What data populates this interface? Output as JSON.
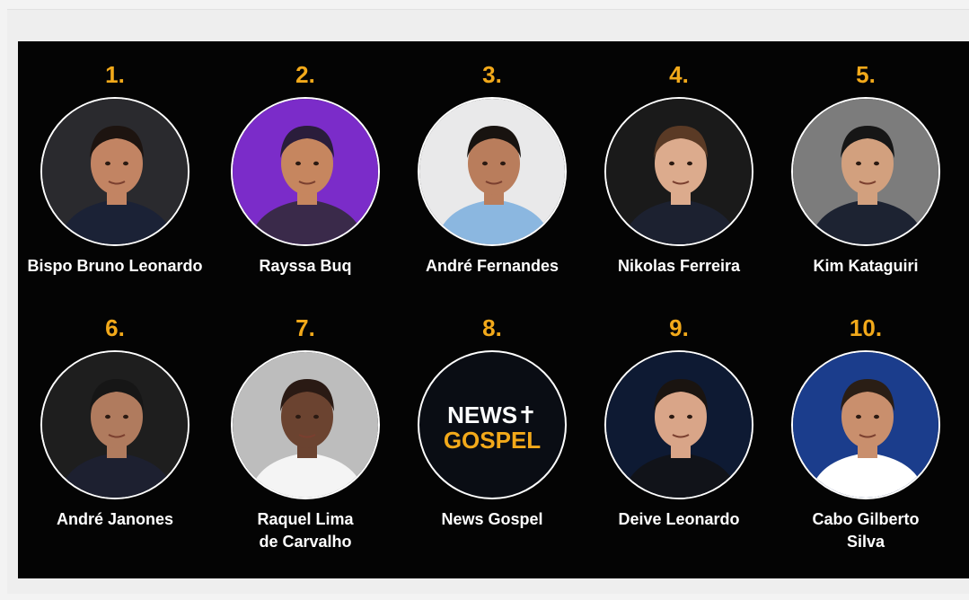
{
  "ranking": [
    {
      "rank": "1.",
      "name": "Bispo Bruno Leonardo",
      "bg": "#2a2a2e",
      "skin": "#c28463",
      "hair": "#1d1410",
      "cloth": "#1b2236"
    },
    {
      "rank": "2.",
      "name": "Rayssa Buq",
      "bg": "#7b2cc9",
      "skin": "#c6865f",
      "hair": "#2a1d3b",
      "cloth": "#3a2a4a"
    },
    {
      "rank": "3.",
      "name": "André Fernandes",
      "bg": "#e9e9ea",
      "skin": "#b97d5c",
      "hair": "#181310",
      "cloth": "#8bb7e0"
    },
    {
      "rank": "4.",
      "name": "Nikolas Ferreira",
      "bg": "#1a1a1a",
      "skin": "#dcab8d",
      "hair": "#5a3a25",
      "cloth": "#1c2130"
    },
    {
      "rank": "5.",
      "name": "Kim Kataguiri",
      "bg": "#7c7c7c",
      "skin": "#d2a07e",
      "hair": "#161616",
      "cloth": "#1d2332"
    },
    {
      "rank": "6.",
      "name": "André Janones",
      "bg": "#1e1e1e",
      "skin": "#b07b5e",
      "hair": "#161616",
      "cloth": "#1d2030"
    },
    {
      "rank": "7.",
      "name": "Raquel Lima\nde Carvalho",
      "bg": "#bdbdbd",
      "skin": "#6b4330",
      "hair": "#2a1a14",
      "cloth": "#f4f4f4"
    },
    {
      "rank": "8.",
      "name": "News Gospel",
      "bg": "#0a0d14",
      "logo": {
        "line1": "NEWS✝",
        "line2": "GOSPEL"
      }
    },
    {
      "rank": "9.",
      "name": "Deive Leonardo",
      "bg": "#0e1a33",
      "skin": "#d9a588",
      "hair": "#1a1410",
      "cloth": "#111319"
    },
    {
      "rank": "10.",
      "name": "Cabo Gilberto\nSilva",
      "bg": "#1b3d8c",
      "skin": "#c98f6d",
      "hair": "#2a1e15",
      "cloth": "#ffffff"
    }
  ]
}
